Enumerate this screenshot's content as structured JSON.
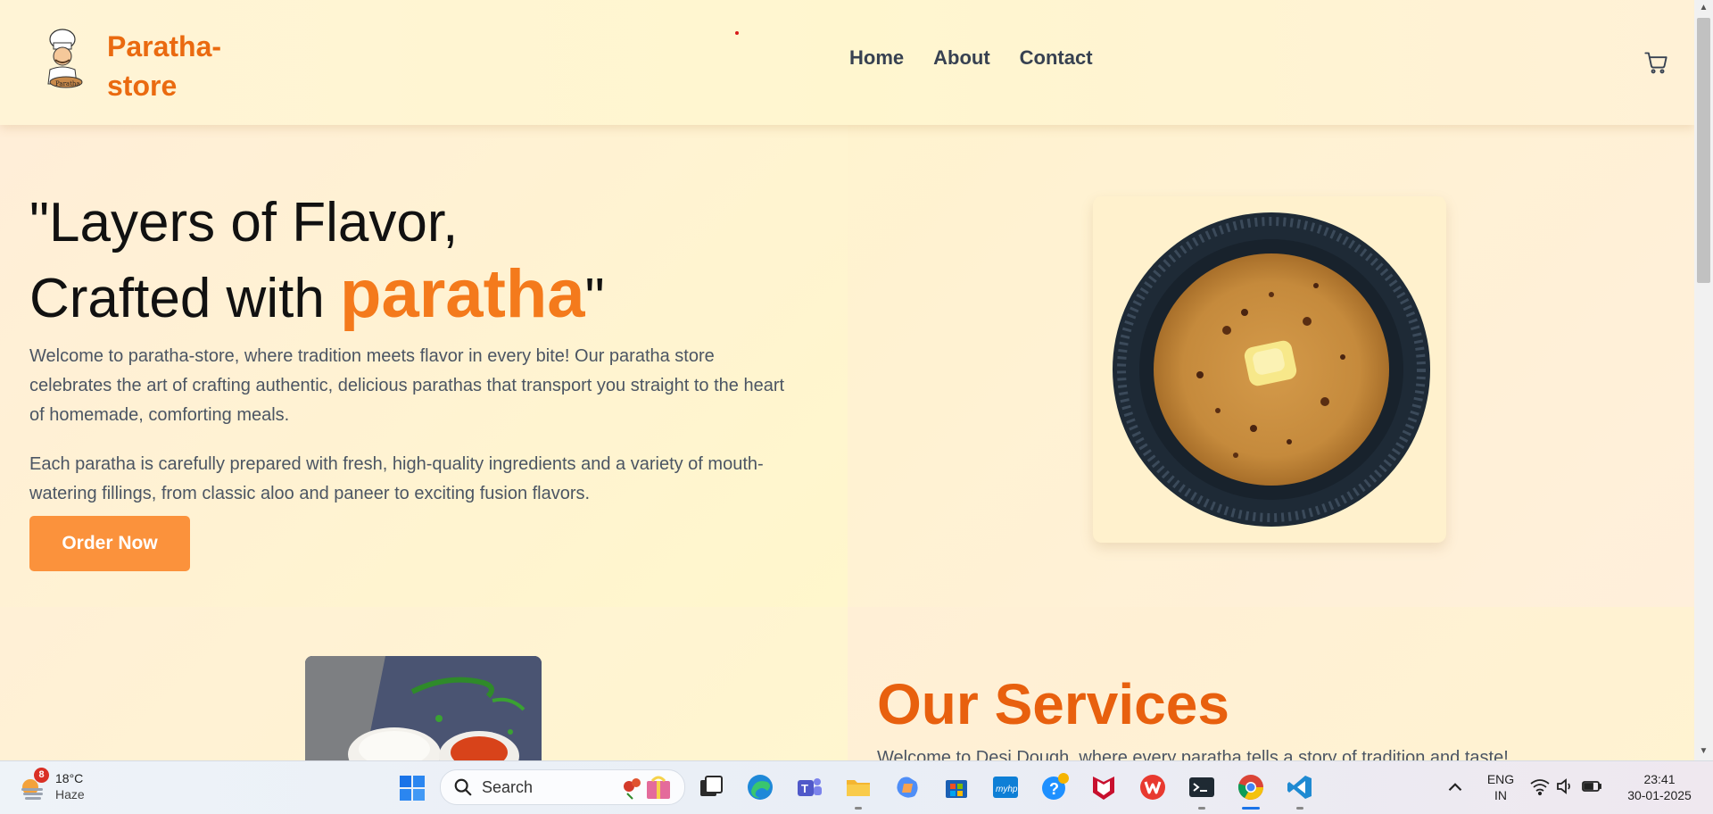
{
  "navbar": {
    "brand": "Paratha-\nstore",
    "links": [
      "Home",
      "About",
      "Contact"
    ]
  },
  "hero": {
    "headline_line1": "\"Layers of Flavor,",
    "headline_line2_prefix": "Crafted with ",
    "headline_accent": "paratha",
    "headline_suffix": "\"",
    "paragraph1": "Welcome to paratha-store, where tradition meets flavor in every bite! Our paratha store celebrates the art of crafting authentic, delicious parathas that transport you straight to the heart of homemade, comforting meals.",
    "paragraph2": "Each paratha is carefully prepared with fresh, high-quality ingredients and a variety of mouth-watering fillings, from classic aloo and paneer to exciting fusion flavors.",
    "cta_label": "Order Now"
  },
  "services": {
    "title": "Our Services",
    "intro": "Welcome to Desi Dough, where every paratha tells a story of tradition and taste!"
  },
  "taskbar": {
    "weather": {
      "badge": "8",
      "temp": "18°C",
      "condition": "Haze"
    },
    "search_placeholder": "Search",
    "language": {
      "line1": "ENG",
      "line2": "IN"
    },
    "clock": {
      "time": "23:41",
      "date": "30-01-2025"
    }
  },
  "colors": {
    "brand_orange": "#ea6a10",
    "accent_orange": "#f47a1c",
    "button_orange": "#fb923c"
  }
}
